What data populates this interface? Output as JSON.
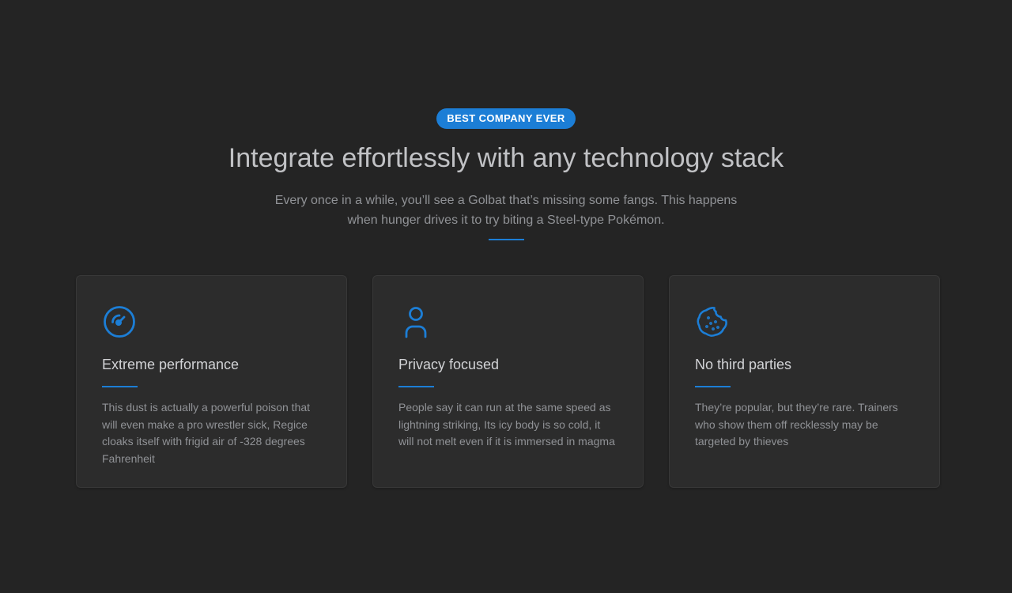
{
  "hero": {
    "badge": "BEST COMPANY EVER",
    "title": "Integrate effortlessly with any technology stack",
    "subtitle": "Every once in a while, you’ll see a Golbat that’s missing some fangs. This happens when hunger drives it to try biting a Steel-type Pokémon."
  },
  "colors": {
    "accent": "#1c7ed6",
    "background": "#242424",
    "card": "#2c2c2c"
  },
  "features": [
    {
      "icon": "gauge-icon",
      "title": "Extreme performance",
      "description": "This dust is actually a powerful poison that will even make a pro wrestler sick, Regice cloaks itself with frigid air of -328 degrees Fahrenheit"
    },
    {
      "icon": "user-icon",
      "title": "Privacy focused",
      "description": "People say it can run at the same speed as lightning striking, Its icy body is so cold, it will not melt even if it is immersed in magma"
    },
    {
      "icon": "cookie-icon",
      "title": "No third parties",
      "description": "They’re popular, but they’re rare. Trainers who show them off recklessly may be targeted by thieves"
    }
  ]
}
